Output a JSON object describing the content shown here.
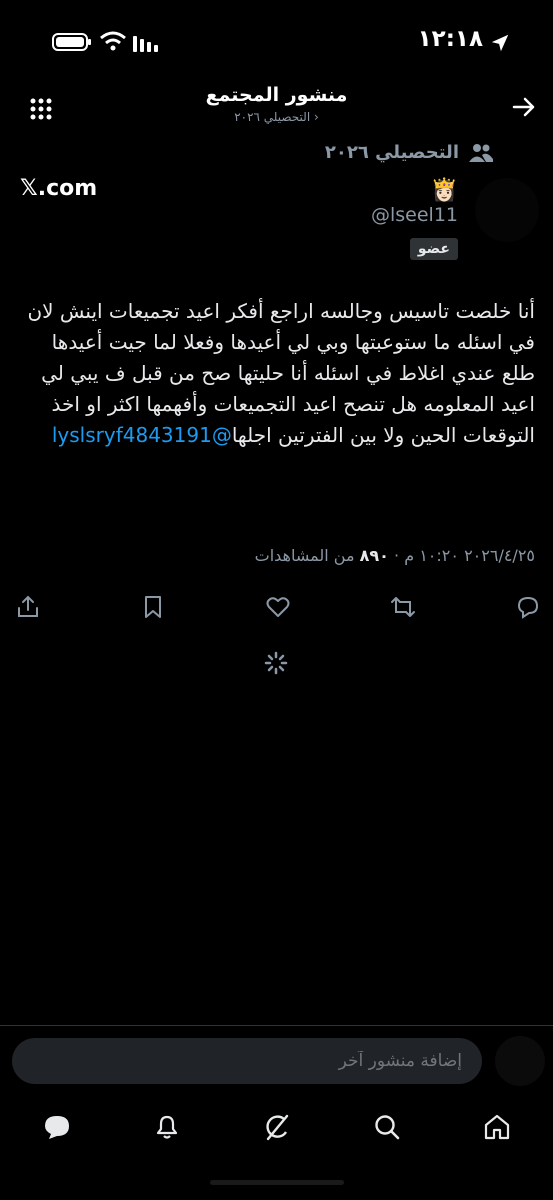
{
  "status_bar": {
    "time": "١٢:١٨",
    "icons": [
      "location-arrow-icon",
      "battery-icon",
      "wifi-icon",
      "signal-icon"
    ]
  },
  "header": {
    "title": "منشور المجتمع",
    "subtitle": "التحصيلي ٢٠٢٦ ›",
    "back_icon": "arrow-right-icon",
    "more_icon": "more-dots-icon"
  },
  "community": {
    "name": "التحصيلي ٢٠٢٦",
    "icon": "people-icon"
  },
  "post": {
    "source": "𝕏.com",
    "emoji": "👸🏻",
    "username": "@lseel11",
    "badge": "عضو",
    "text": "أنا خلصت تاسيس وجالسه اراجع أفكر اعيد تجميعات اينش لان في اسئله ما ستوعبتها وبي لي أعيدها وفعلا لما جيت أعيدها طلع عندي اغلاط في اسئله أنا حليتها صح من قبل ف يبي لي اعيد المعلومه هل تنصح اعيد التجميعات وأفهمها اكثر او اخذ التوقعات الحين ولا بين الفترتين اجلها",
    "mention": "@lyslsryf4843191",
    "date_time": "٢٠٢٦/٤/٢٥ ١٠:٢٠ م ·",
    "views_count": "٨٩٠",
    "views_label": "من المشاهدات"
  },
  "actions": [
    "reply-icon",
    "retweet-icon",
    "like-icon",
    "bookmark-icon",
    "share-icon"
  ],
  "composer": {
    "placeholder": "إضافة منشور آخر"
  },
  "nav": [
    "home-icon",
    "search-icon",
    "grok-icon",
    "notifications-icon",
    "messages-icon"
  ],
  "colors": {
    "background": "#000000",
    "text": "#e7e9ea",
    "muted": "#8b98a5",
    "accent": "#1d9bf0"
  }
}
